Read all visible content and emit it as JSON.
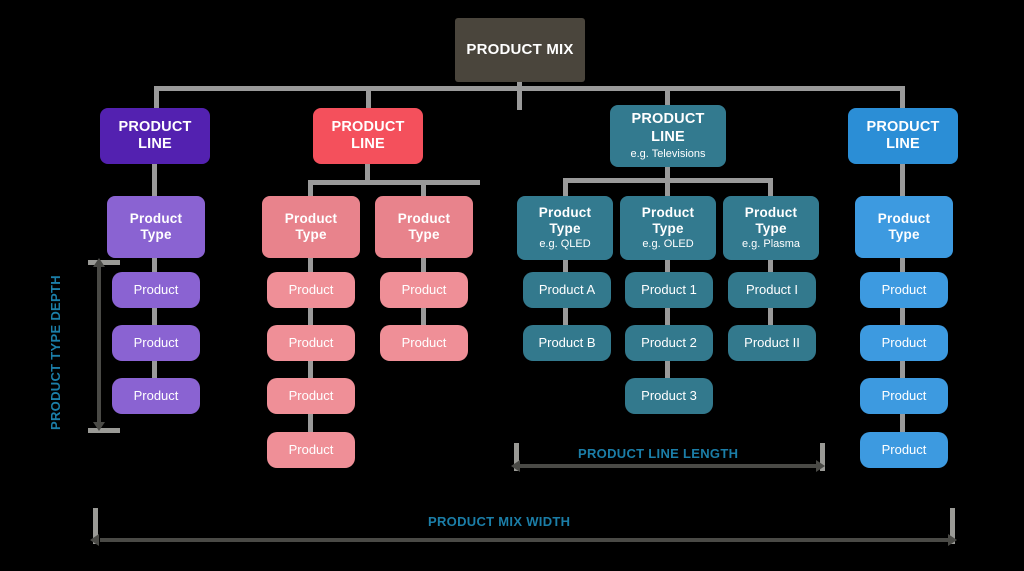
{
  "diagram": {
    "title": "PRODUCT MIX",
    "root": {
      "label": "PRODUCT MIX",
      "color": "#4a453c"
    },
    "colors": {
      "root": "#4a453c",
      "purple_line": "#5321b0",
      "purple_type": "#8a63d2",
      "purple_product": "#8a63d2",
      "red_line": "#f4505c",
      "pink_type": "#e8838c",
      "pink_product": "#ef8f97",
      "teal_line": "#337a8f",
      "teal_type": "#337a8f",
      "teal_product": "#33798d",
      "blue_line": "#2b8ed6",
      "blue_type": "#3d9ae0",
      "blue_product": "#3d9ae0",
      "connector": "#9a9a9a",
      "measure_bar": "#4a4a46",
      "measure_label": "#1b7ea8",
      "background": "#000000",
      "text": "#ffffff"
    },
    "columns": [
      {
        "id": "purple",
        "line": {
          "title": "PRODUCT",
          "title2": "LINE",
          "sub": ""
        },
        "types": [
          {
            "title": "Product",
            "title2": "Type",
            "sub": "",
            "products": [
              "Product",
              "Product",
              "Product"
            ]
          }
        ]
      },
      {
        "id": "red",
        "line": {
          "title": "PRODUCT",
          "title2": "LINE",
          "sub": ""
        },
        "types": [
          {
            "title": "Product",
            "title2": "Type",
            "sub": "",
            "products": [
              "Product",
              "Product",
              "Product",
              "Product"
            ]
          },
          {
            "title": "Product",
            "title2": "Type",
            "sub": "",
            "products": [
              "Product",
              "Product"
            ]
          }
        ]
      },
      {
        "id": "teal",
        "line": {
          "title": "PRODUCT",
          "title2": "LINE",
          "sub": "e.g. Televisions"
        },
        "types": [
          {
            "title": "Product",
            "title2": "Type",
            "sub": "e.g. QLED",
            "products": [
              "Product A",
              "Product B"
            ]
          },
          {
            "title": "Product",
            "title2": "Type",
            "sub": "e.g. OLED",
            "products": [
              "Product 1",
              "Product 2",
              "Product 3"
            ]
          },
          {
            "title": "Product",
            "title2": "Type",
            "sub": "e.g. Plasma",
            "products": [
              "Product I",
              "Product II"
            ]
          }
        ]
      },
      {
        "id": "blue",
        "line": {
          "title": "PRODUCT",
          "title2": "LINE",
          "sub": ""
        },
        "types": [
          {
            "title": "Product",
            "title2": "Type",
            "sub": "",
            "products": [
              "Product",
              "Product",
              "Product",
              "Product"
            ]
          }
        ]
      }
    ],
    "measures": {
      "depth": "PRODUCT TYPE DEPTH",
      "length": "PRODUCT LINE LENGTH",
      "width": "PRODUCT MIX WIDTH"
    }
  }
}
